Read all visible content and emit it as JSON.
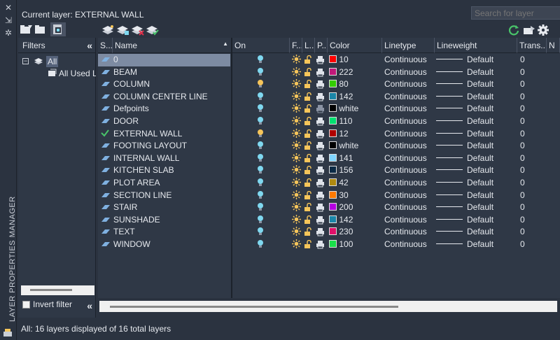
{
  "panel": {
    "title": "LAYER PROPERTIES MANAGER",
    "current_layer": "Current layer: EXTERNAL WALL",
    "search_placeholder": "Search for layer"
  },
  "filters": {
    "title": "Filters",
    "tree_all": "All",
    "tree_used": "All Used Layers",
    "invert_filter": "Invert filter"
  },
  "columns": [
    "S...",
    "Name",
    "On",
    "F...",
    "L...",
    "P...",
    "Color",
    "Linetype",
    "Lineweight",
    "Trans...",
    "N"
  ],
  "layers": [
    {
      "name": "0",
      "on_color": "#7fd8f0",
      "color_hex": "#ff0000",
      "color": "10",
      "linetype": "Continuous",
      "lineweight": "Default",
      "trans": "0",
      "current": false,
      "selected": true,
      "plot": true
    },
    {
      "name": "BEAM",
      "on_color": "#7fd8f0",
      "color_hex": "#c0187a",
      "color": "222",
      "linetype": "Continuous",
      "lineweight": "Default",
      "trans": "0",
      "current": false,
      "selected": false,
      "plot": true
    },
    {
      "name": "COLUMN",
      "on_color": "#f6c55a",
      "color_hex": "#33cc00",
      "color": "80",
      "linetype": "Continuous",
      "lineweight": "Default",
      "trans": "0",
      "current": false,
      "selected": false,
      "plot": true
    },
    {
      "name": "COLUMN CENTER LINE",
      "on_color": "#7fd8f0",
      "color_hex": "#1b86a8",
      "color": "142",
      "linetype": "Continuous",
      "lineweight": "Default",
      "trans": "0",
      "current": false,
      "selected": false,
      "plot": true
    },
    {
      "name": "Defpoints",
      "on_color": "#7fd8f0",
      "color_hex": "#000000",
      "color": "white",
      "linetype": "Continuous",
      "lineweight": "Default",
      "trans": "0",
      "current": false,
      "selected": false,
      "plot": false
    },
    {
      "name": "DOOR",
      "on_color": "#7fd8f0",
      "color_hex": "#00e070",
      "color": "110",
      "linetype": "Continuous",
      "lineweight": "Default",
      "trans": "0",
      "current": false,
      "selected": false,
      "plot": true
    },
    {
      "name": "EXTERNAL WALL",
      "on_color": "#f6c55a",
      "color_hex": "#b00000",
      "color": "12",
      "linetype": "Continuous",
      "lineweight": "Default",
      "trans": "0",
      "current": true,
      "selected": false,
      "plot": true
    },
    {
      "name": "FOOTING LAYOUT",
      "on_color": "#7fd8f0",
      "color_hex": "#000000",
      "color": "white",
      "linetype": "Continuous",
      "lineweight": "Default",
      "trans": "0",
      "current": false,
      "selected": false,
      "plot": true
    },
    {
      "name": "INTERNAL WALL",
      "on_color": "#7fd8f0",
      "color_hex": "#7fd4ff",
      "color": "141",
      "linetype": "Continuous",
      "lineweight": "Default",
      "trans": "0",
      "current": false,
      "selected": false,
      "plot": true
    },
    {
      "name": "KITCHEN SLAB",
      "on_color": "#7fd8f0",
      "color_hex": "#0b2a45",
      "color": "156",
      "linetype": "Continuous",
      "lineweight": "Default",
      "trans": "0",
      "current": false,
      "selected": false,
      "plot": true
    },
    {
      "name": "PLOT AREA",
      "on_color": "#7fd8f0",
      "color_hex": "#b08a10",
      "color": "42",
      "linetype": "Continuous",
      "lineweight": "Default",
      "trans": "0",
      "current": false,
      "selected": false,
      "plot": true
    },
    {
      "name": "SECTION LINE",
      "on_color": "#7fd8f0",
      "color_hex": "#ff7a00",
      "color": "30",
      "linetype": "Continuous",
      "lineweight": "Default",
      "trans": "0",
      "current": false,
      "selected": false,
      "plot": true
    },
    {
      "name": "STAIR",
      "on_color": "#7fd8f0",
      "color_hex": "#b400e0",
      "color": "200",
      "linetype": "Continuous",
      "lineweight": "Default",
      "trans": "0",
      "current": false,
      "selected": false,
      "plot": true
    },
    {
      "name": "SUNSHADE",
      "on_color": "#7fd8f0",
      "color_hex": "#1b86a8",
      "color": "142",
      "linetype": "Continuous",
      "lineweight": "Default",
      "trans": "0",
      "current": false,
      "selected": false,
      "plot": true
    },
    {
      "name": "TEXT",
      "on_color": "#7fd8f0",
      "color_hex": "#e0106a",
      "color": "230",
      "linetype": "Continuous",
      "lineweight": "Default",
      "trans": "0",
      "current": false,
      "selected": false,
      "plot": true
    },
    {
      "name": "WINDOW",
      "on_color": "#7fd8f0",
      "color_hex": "#19e04a",
      "color": "100",
      "linetype": "Continuous",
      "lineweight": "Default",
      "trans": "0",
      "current": false,
      "selected": false,
      "plot": true
    }
  ],
  "status": "All: 16 layers displayed of 16 total layers"
}
